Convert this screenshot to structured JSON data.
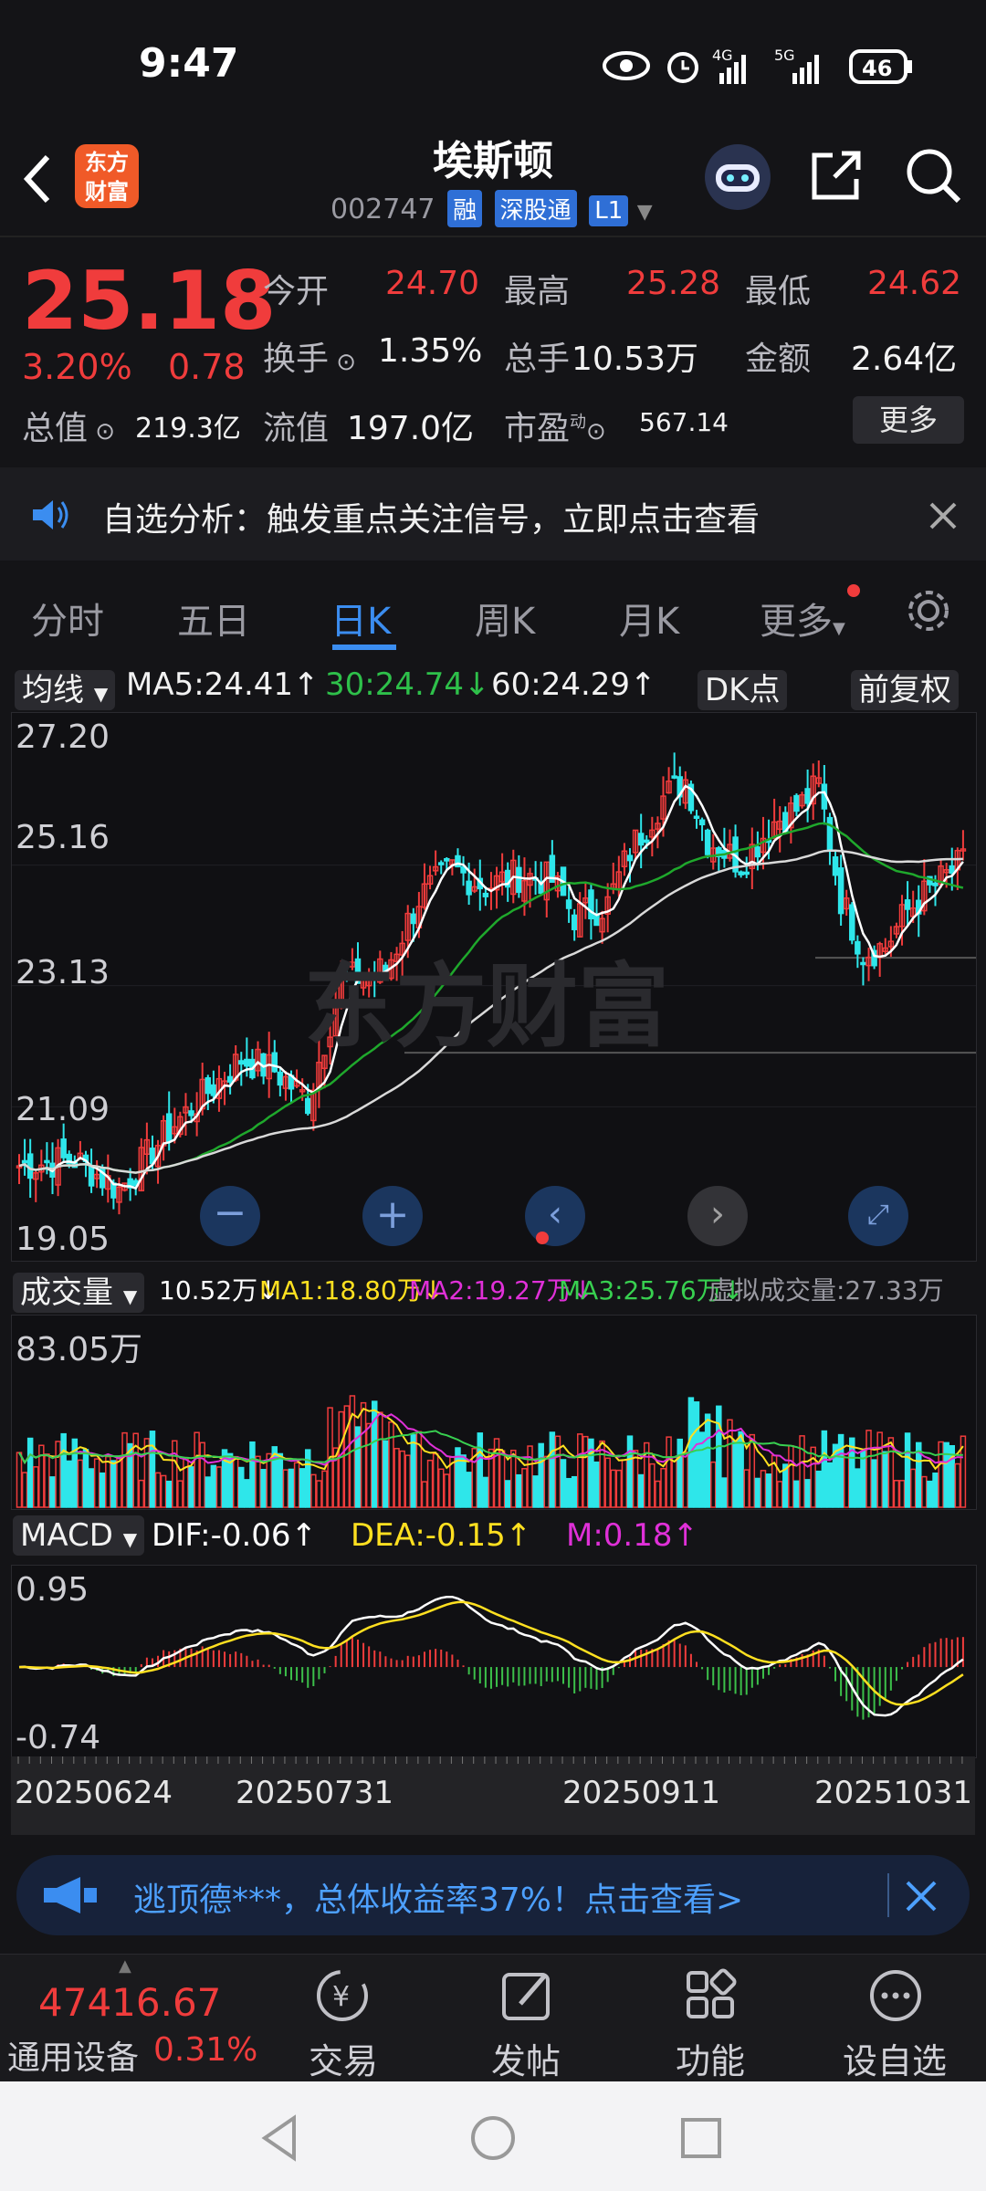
{
  "status": {
    "time": "9:47",
    "battery": "46",
    "sig1": "4G",
    "sig2": "5G"
  },
  "header": {
    "title": "埃斯顿",
    "code": "002747",
    "tags": [
      "融",
      "深股通",
      "L1"
    ],
    "logo_text": "东方财富"
  },
  "quote": {
    "price": "25.18",
    "pct": "3.20%",
    "change": "0.78",
    "items": [
      {
        "label": "今开",
        "value": "24.70"
      },
      {
        "label": "最高",
        "value": "25.28"
      },
      {
        "label": "最低",
        "value": "24.62"
      },
      {
        "label": "换手",
        "value": "1.35%"
      },
      {
        "label": "总手",
        "value": "10.53万"
      },
      {
        "label": "金额",
        "value": "2.64亿"
      },
      {
        "label": "总值",
        "value": "219.3亿"
      },
      {
        "label": "流值",
        "value": "197.0亿"
      },
      {
        "label": "市盈",
        "value": "567.14"
      }
    ],
    "pe_sup": "动",
    "more_btn": "更多"
  },
  "notice": {
    "text": "自选分析：触发重点关注信号，立即点击查看"
  },
  "tabs": [
    "分时",
    "五日",
    "日K",
    "周K",
    "月K",
    "更多"
  ],
  "active_tab": "日K",
  "ma_bar": {
    "selector": "均线",
    "ma5": "MA5:24.41",
    "ma30": "30:24.74",
    "ma60": "60:24.29",
    "dk": "DK点",
    "fq": "前复权"
  },
  "kline": {
    "yticks": [
      "27.20",
      "25.16",
      "23.13",
      "21.09",
      "19.05"
    ],
    "watermark": "东方财富"
  },
  "volume": {
    "selector": "成交量",
    "cur": "10.52万",
    "ma1": "MA1:18.80万",
    "ma2": "MA2:19.27万",
    "ma3": "MA3:25.76万",
    "virtual": "虚拟成交量:27.33万",
    "ymax": "83.05万"
  },
  "macd": {
    "selector": "MACD",
    "dif": "DIF:-0.06",
    "dea": "DEA:-0.15",
    "m": "M:0.18",
    "ymax": "0.95",
    "ymin": "-0.74"
  },
  "dates": [
    "20250624",
    "20250731",
    "20250911",
    "20251031"
  ],
  "ad": {
    "text": "逃顶德***，总体收益率37%！点击查看>"
  },
  "index": {
    "value": "47416.67",
    "name": "通用设备",
    "pct": "0.31%"
  },
  "bottom_nav": [
    "交易",
    "发帖",
    "功能",
    "设自选"
  ],
  "colors": {
    "up": "#f03c3c",
    "down": "#2ee6ea",
    "ma5": "#ffffff",
    "ma30": "#1fa82c",
    "ma60": "#d9d9d9"
  }
}
